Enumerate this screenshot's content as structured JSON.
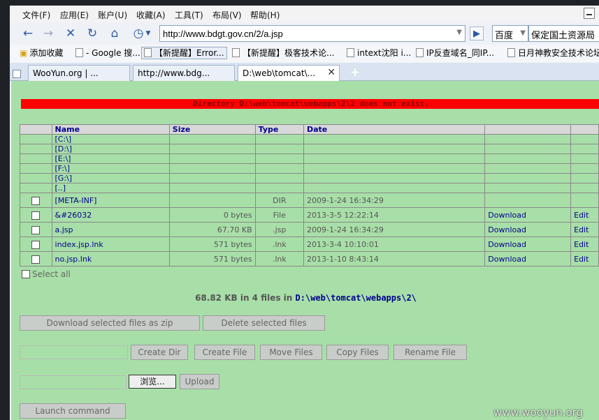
{
  "menu": [
    "文件(F)",
    "应用(E)",
    "账户(U)",
    "收藏(A)",
    "工具(T)",
    "布局(V)",
    "帮助(H)"
  ],
  "address": {
    "url": "http://www.bdgt.gov.cn/2/a.jsp"
  },
  "search": {
    "engine": "百度",
    "query": "保定国土资源局"
  },
  "bookmarks": [
    "添加收藏",
    "- Google 搜...",
    "【新提醒】Error...",
    "【新提醒】极客技术论...",
    "intext沈阳 i...",
    "IP反查域名_同IP...",
    "日月神教安全技术论坛"
  ],
  "tabs": [
    "WooYun.org | ...",
    "http://www.bdg...",
    "D:\\web\\tomcat\\..."
  ],
  "page": {
    "error": "Directory D:\\web\\tomcat\\webapps\\2\\2 does not exist.",
    "headers": {
      "name": "Name",
      "size": "Size",
      "type": "Type",
      "date": "Date"
    },
    "drives": [
      "[C:\\]",
      "[D:\\]",
      "[E:\\]",
      "[F:\\]",
      "[G:\\]",
      "[..]"
    ],
    "meta_dir": {
      "name": "[META-INF]",
      "type": "DIR",
      "date": "2009-1-24 16:34:29"
    },
    "files": [
      {
        "name": "&#26032",
        "size": "0 bytes",
        "type": "File",
        "date": "2013-3-5 12:22:14",
        "download": "Download",
        "edit": "Edit"
      },
      {
        "name": "a.jsp",
        "size": "67.70 KB",
        "type": ".jsp",
        "date": "2009-1-24 16:34:29",
        "download": "Download",
        "edit": "Edit"
      },
      {
        "name": "index.jsp.lnk",
        "size": "571 bytes",
        "type": ".lnk",
        "date": "2013-3-4 10:10:01",
        "download": "Download",
        "edit": "Edit"
      },
      {
        "name": "no.jsp.lnk",
        "size": "571 bytes",
        "type": ".lnk",
        "date": "2013-1-10 8:43:14",
        "download": "Download",
        "edit": "Edit"
      }
    ],
    "select_all": "Select all",
    "summary_prefix": "68.82 KB in 4 files in",
    "summary_path": "D:\\web\\tomcat\\webapps\\2\\",
    "buttons": {
      "download_zip": "Download selected files as zip",
      "delete_selected": "Delete selected files",
      "create_dir": "Create Dir",
      "create_file": "Create File",
      "move_files": "Move Files",
      "copy_files": "Copy Files",
      "rename_file": "Rename File",
      "browse": "浏览...",
      "upload": "Upload",
      "launch": "Launch command"
    }
  },
  "watermark": "www.wooyun.org"
}
